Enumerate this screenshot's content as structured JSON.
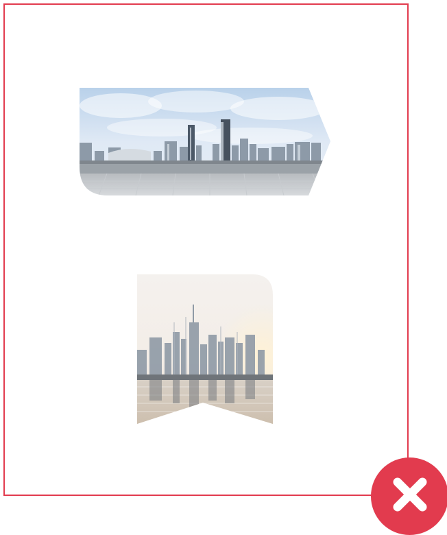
{
  "icons": {
    "close": "close-icon"
  },
  "colors": {
    "frame": "#e23b4e",
    "badge": "#e23b4e",
    "icon": "#ffffff"
  }
}
